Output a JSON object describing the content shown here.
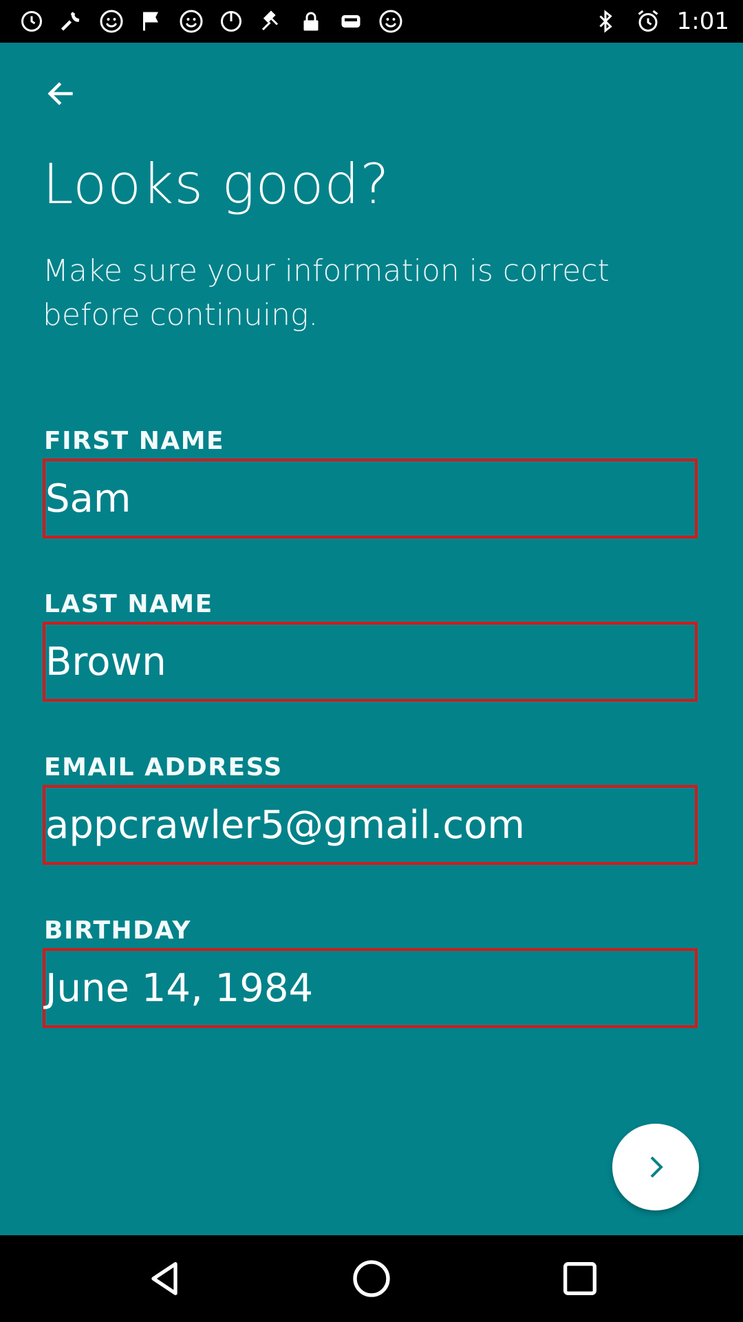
{
  "status_bar": {
    "time": "1:01",
    "left_icons": [
      "clock-icon",
      "wrench-icon",
      "smiley-icon",
      "flag-icon",
      "smiley-icon",
      "dnd-icon",
      "fake-gps-icon",
      "lock-icon",
      "toggle-icon",
      "smiley-icon",
      "bluetooth-icon",
      "alarm-icon"
    ]
  },
  "header": {
    "title": "Looks good?",
    "subtitle": "Make sure your information is correct before continuing."
  },
  "form": {
    "first_name": {
      "label": "FIRST NAME",
      "value": "Sam"
    },
    "last_name": {
      "label": "LAST NAME",
      "value": "Brown"
    },
    "email": {
      "label": "EMAIL ADDRESS",
      "value": "appcrawler5@gmail.com"
    },
    "birthday": {
      "label": "BIRTHDAY",
      "value": "June 14, 1984"
    }
  },
  "colors": {
    "background": "#03828a",
    "highlight_border": "#d11b1b",
    "text": "#ffffff"
  },
  "icons": {
    "back": "arrow-left-icon",
    "next": "chevron-right-icon",
    "nav_back": "triangle-back-icon",
    "nav_home": "circle-home-icon",
    "nav_recents": "square-recents-icon"
  }
}
